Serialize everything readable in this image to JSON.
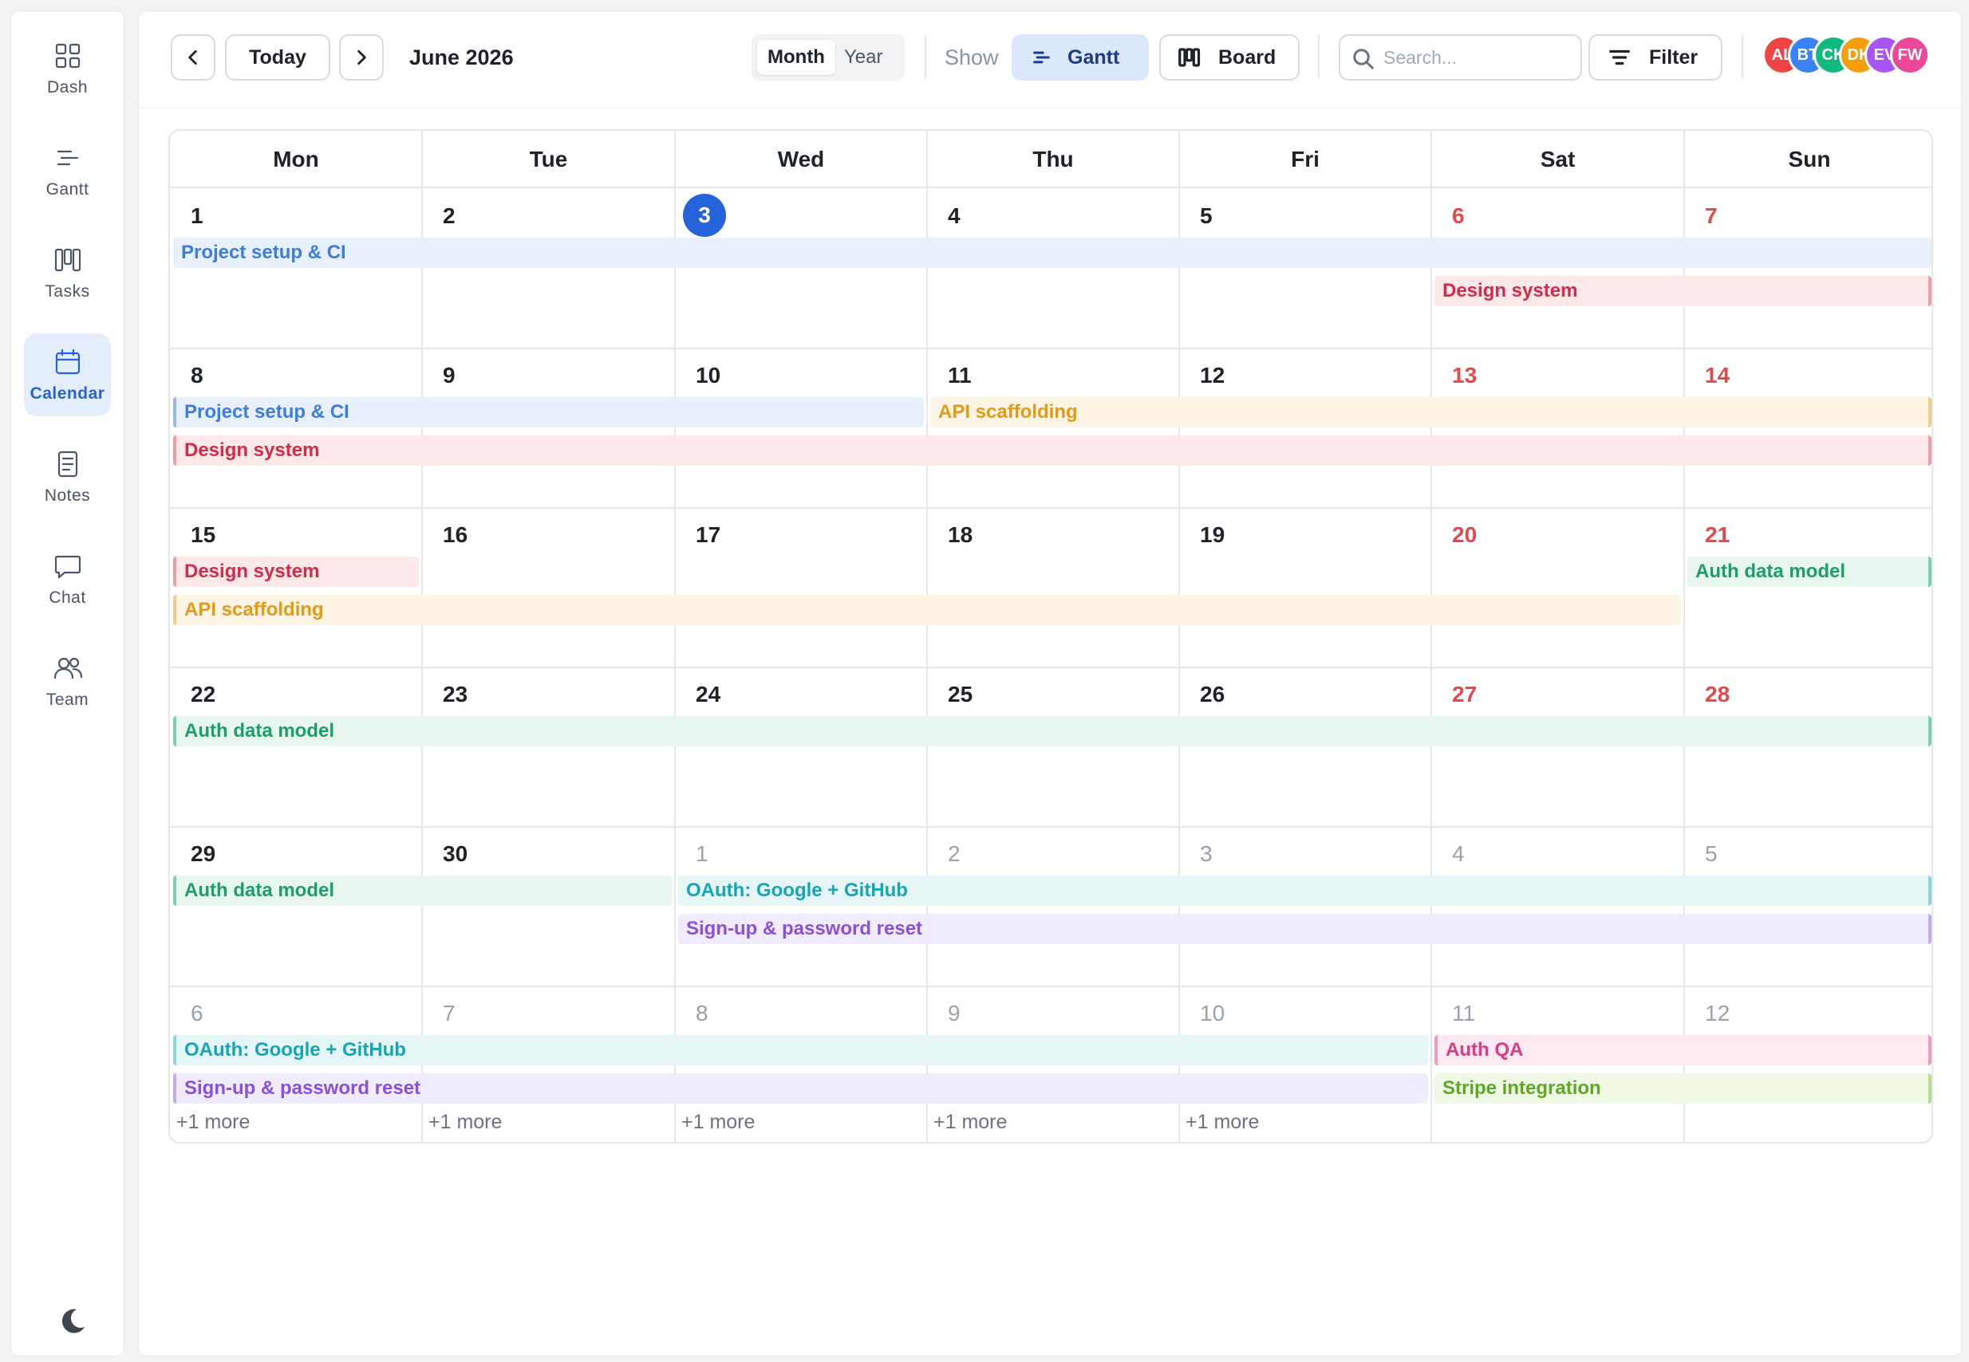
{
  "sidebar": {
    "items": [
      {
        "label": "Dash",
        "icon": "grid-icon",
        "active": false
      },
      {
        "label": "Gantt",
        "icon": "gantt-icon",
        "active": false
      },
      {
        "label": "Tasks",
        "icon": "kanban-icon",
        "active": false
      },
      {
        "label": "Calendar",
        "icon": "calendar-icon",
        "active": true
      },
      {
        "label": "Notes",
        "icon": "document-icon",
        "active": false
      },
      {
        "label": "Chat",
        "icon": "chat-bubble-icon",
        "active": false
      },
      {
        "label": "Team",
        "icon": "users-icon",
        "active": false
      }
    ],
    "theme_icon": "moon-icon"
  },
  "toolbar": {
    "prev_icon": "chevron-left-icon",
    "today_label": "Today",
    "next_icon": "chevron-right-icon",
    "title": "June 2026",
    "view_toggle": {
      "options": [
        "Month",
        "Year"
      ],
      "selected": "Month"
    },
    "show_label": "Show",
    "gantt_label": "Gantt",
    "board_label": "Board",
    "search_placeholder": "Search...",
    "filter_label": "Filter",
    "avatars": [
      {
        "initials": "AL",
        "color": "#ef4444"
      },
      {
        "initials": "BT",
        "color": "#3b82f6"
      },
      {
        "initials": "CK",
        "color": "#10b981"
      },
      {
        "initials": "DK",
        "color": "#f59e0b"
      },
      {
        "initials": "EV",
        "color": "#a855f7"
      },
      {
        "initials": "FW",
        "color": "#ec4899"
      }
    ]
  },
  "calendar": {
    "weekdays": [
      "Mon",
      "Tue",
      "Wed",
      "Thu",
      "Fri",
      "Sat",
      "Sun"
    ],
    "weeks": [
      {
        "days": [
          "1",
          "2",
          "3",
          "4",
          "5",
          "6",
          "7"
        ],
        "out_of_month": [
          false,
          false,
          false,
          false,
          false,
          false,
          false
        ],
        "today_index": 2,
        "events": [
          {
            "title": "Project setup & CI",
            "color": "blue",
            "lane": 0,
            "start": 0,
            "end": 6,
            "continues_left": false,
            "ends_here": true
          },
          {
            "title": "Design system",
            "color": "red",
            "lane": 1,
            "start": 5,
            "end": 6,
            "continues_left": false,
            "ends_here": false
          }
        ],
        "more": []
      },
      {
        "days": [
          "8",
          "9",
          "10",
          "11",
          "12",
          "13",
          "14"
        ],
        "out_of_month": [
          false,
          false,
          false,
          false,
          false,
          false,
          false
        ],
        "today_index": -1,
        "events": [
          {
            "title": "Project setup & CI",
            "color": "blue",
            "lane": 0,
            "start": 0,
            "end": 2,
            "continues_left": true,
            "ends_here": true
          },
          {
            "title": "API scaffolding",
            "color": "orange",
            "lane": 0,
            "start": 3,
            "end": 6,
            "continues_left": false,
            "ends_here": false
          },
          {
            "title": "Design system",
            "color": "red",
            "lane": 1,
            "start": 0,
            "end": 6,
            "continues_left": true,
            "ends_here": false
          }
        ],
        "more": []
      },
      {
        "days": [
          "15",
          "16",
          "17",
          "18",
          "19",
          "20",
          "21"
        ],
        "out_of_month": [
          false,
          false,
          false,
          false,
          false,
          false,
          false
        ],
        "today_index": -1,
        "events": [
          {
            "title": "Design system",
            "color": "red",
            "lane": 0,
            "start": 0,
            "end": 0,
            "continues_left": true,
            "ends_here": true
          },
          {
            "title": "Auth data model",
            "color": "green",
            "lane": 0,
            "start": 6,
            "end": 6,
            "continues_left": false,
            "ends_here": false
          },
          {
            "title": "API scaffolding",
            "color": "orange",
            "lane": 1,
            "start": 0,
            "end": 5,
            "continues_left": true,
            "ends_here": true
          }
        ],
        "more": []
      },
      {
        "days": [
          "22",
          "23",
          "24",
          "25",
          "26",
          "27",
          "28"
        ],
        "out_of_month": [
          false,
          false,
          false,
          false,
          false,
          false,
          false
        ],
        "today_index": -1,
        "events": [
          {
            "title": "Auth data model",
            "color": "green",
            "lane": 0,
            "start": 0,
            "end": 6,
            "continues_left": true,
            "ends_here": false
          }
        ],
        "more": []
      },
      {
        "days": [
          "29",
          "30",
          "1",
          "2",
          "3",
          "4",
          "5"
        ],
        "out_of_month": [
          false,
          false,
          true,
          true,
          true,
          true,
          true
        ],
        "today_index": -1,
        "events": [
          {
            "title": "Auth data model",
            "color": "green",
            "lane": 0,
            "start": 0,
            "end": 1,
            "continues_left": true,
            "ends_here": true
          },
          {
            "title": "OAuth: Google + GitHub",
            "color": "teal",
            "lane": 0,
            "start": 2,
            "end": 6,
            "continues_left": false,
            "ends_here": false
          },
          {
            "title": "Sign-up & password reset",
            "color": "purple",
            "lane": 1,
            "start": 2,
            "end": 6,
            "continues_left": false,
            "ends_here": false
          }
        ],
        "more": []
      },
      {
        "days": [
          "6",
          "7",
          "8",
          "9",
          "10",
          "11",
          "12"
        ],
        "out_of_month": [
          true,
          true,
          true,
          true,
          true,
          true,
          true
        ],
        "today_index": -1,
        "events": [
          {
            "title": "OAuth: Google + GitHub",
            "color": "teal",
            "lane": 0,
            "start": 0,
            "end": 4,
            "continues_left": true,
            "ends_here": true
          },
          {
            "title": "Auth QA",
            "color": "pink",
            "lane": 0,
            "start": 5,
            "end": 6,
            "continues_left": true,
            "ends_here": false
          },
          {
            "title": "Sign-up & password reset",
            "color": "purple",
            "lane": 1,
            "start": 0,
            "end": 4,
            "continues_left": true,
            "ends_here": true
          },
          {
            "title": "Stripe integration",
            "color": "lime",
            "lane": 1,
            "start": 5,
            "end": 6,
            "continues_left": false,
            "ends_here": false
          }
        ],
        "more": [
          "+1 more",
          "+1 more",
          "+1 more",
          "+1 more",
          "+1 more"
        ]
      }
    ]
  },
  "colors": {
    "accent": "#2463d9",
    "weekend_date": "#e5484d",
    "blue": {
      "bg": "#e8f0fc",
      "text": "#3b7de0",
      "edge": "#93b7ee"
    },
    "red": {
      "bg": "#fde8ea",
      "text": "#d62a4a",
      "edge": "#f19aa8"
    },
    "orange": {
      "bg": "#fef4e6",
      "text": "#e59a13",
      "edge": "#f5c987"
    },
    "green": {
      "bg": "#e8f6f0",
      "text": "#1a9e6a",
      "edge": "#7ccfae"
    },
    "teal": {
      "bg": "#e6f6f6",
      "text": "#13a6b7",
      "edge": "#8bd4dc"
    },
    "purple": {
      "bg": "#f1ecfd",
      "text": "#8a4fe0",
      "edge": "#c4a8f2"
    },
    "pink": {
      "bg": "#fde9f1",
      "text": "#dd3a83",
      "edge": "#f19ac1"
    },
    "lime": {
      "bg": "#eef8e4",
      "text": "#5fa826",
      "edge": "#b3dc8e"
    }
  }
}
